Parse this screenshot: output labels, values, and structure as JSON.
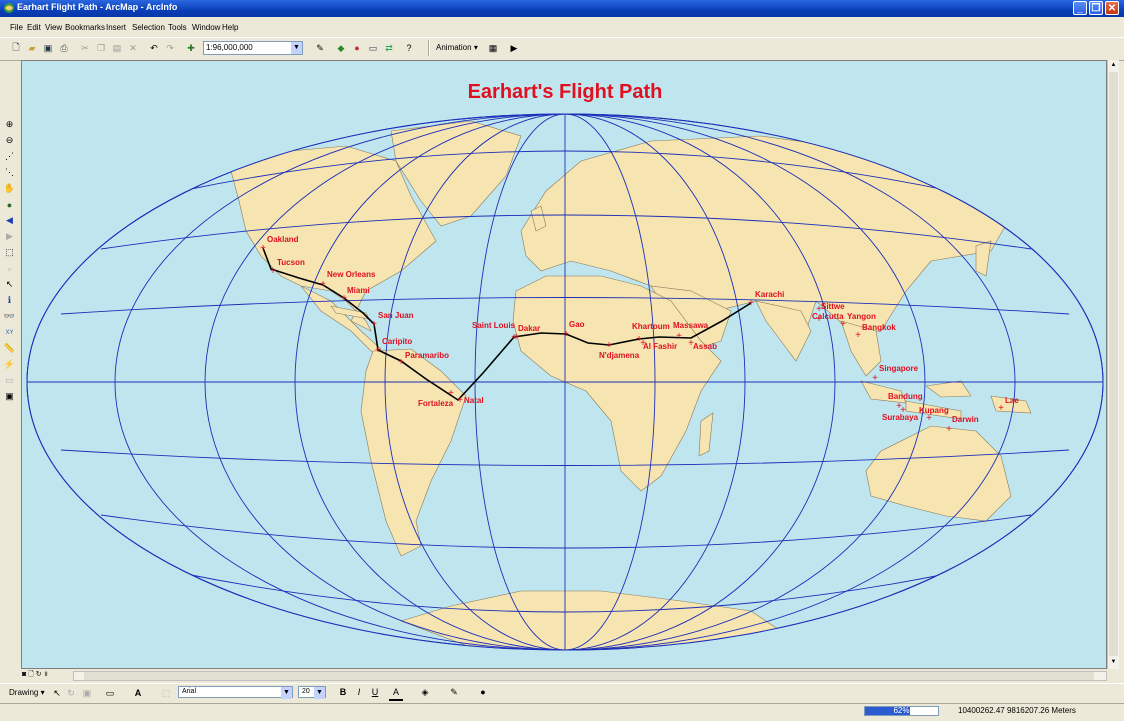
{
  "window": {
    "title": "Earhart Flight Path - ArcMap - ArcInfo"
  },
  "menu": [
    "File",
    "Edit",
    "View",
    "Bookmarks",
    "Insert",
    "Selection",
    "Tools",
    "Window",
    "Help"
  ],
  "toolbar": {
    "scale": "1:96,000,000",
    "animation_label": "Animation"
  },
  "map": {
    "title": "Earhart's Flight Path",
    "colors": {
      "ocean": "#bfe6ef",
      "land": "#f6e4b1",
      "graticule": "#1c2fb8",
      "labels": "#e01020",
      "route": "#000000"
    },
    "cities": [
      "Oakland",
      "Tucson",
      "New Orleans",
      "Miami",
      "San Juan",
      "Caripito",
      "Paramaribo",
      "Fortaleza",
      "Natal",
      "Saint Louis",
      "Dakar",
      "Gao",
      "N'djamena",
      "Khartoum",
      "Massawa",
      "Al Fashir",
      "Assab",
      "Karachi",
      "Calcutta",
      "Sittwe",
      "Yangon",
      "Bangkok",
      "Singapore",
      "Bandung",
      "Surabaya",
      "Kupang",
      "Darwin",
      "Lae"
    ]
  },
  "drawing": {
    "label": "Drawing",
    "font": "Arial",
    "size": "20",
    "bold": "B",
    "italic": "I",
    "underline": "U",
    "font_color": "A"
  },
  "status": {
    "progress_text": "62%",
    "progress": 0.62,
    "coords": "10400262.47  9816207.26 Meters"
  }
}
